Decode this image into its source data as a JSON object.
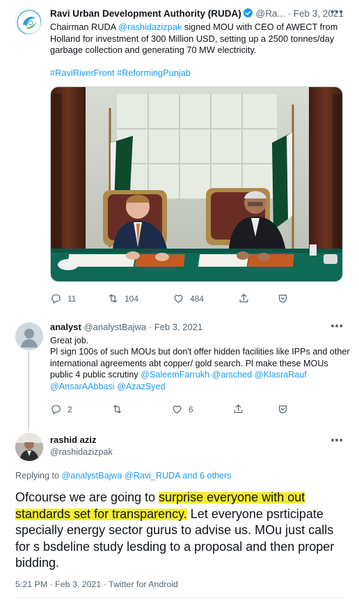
{
  "tweet1": {
    "author_name": "Ravi Urban Development Authority (RUDA)",
    "author_handle_trunc": "@Ra...",
    "separator": "·",
    "date": "Feb 3, 2021",
    "text_pre": "Chairman RUDA ",
    "mention": "@rashidazizpak",
    "text_post": " signed MOU with CEO of AWECT from Holland for investment of 300 Million USD, setting up a 2500 tonnes/day garbage collection and generating 70 MW electricity.",
    "hashtag1": "#RaviRiverFront",
    "hashtag2": "#ReformingPunjab",
    "replies": "11",
    "retweets": "104",
    "likes": "484",
    "icons": [
      "reply-icon",
      "retweet-icon",
      "like-icon",
      "share-icon",
      "tip-icon"
    ]
  },
  "tweet2": {
    "author_name": "analyst",
    "author_handle": "@analystBajwa",
    "separator": "·",
    "date": "Feb 3, 2021",
    "line1": "Great job.",
    "line2": "Pl sign 100s of such MOUs but don't offer hidden facilities like IPPs and other international agreements abt copper/ gold search. Pl make these MOUs public 4 public scrutiny ",
    "mentions": [
      "@SaleemFarrukh",
      "@arsched",
      "@KlasraRauf",
      "@AnsarAAbbasi",
      "@AzazSyed"
    ],
    "replies": "2",
    "retweets": "",
    "likes": "6"
  },
  "tweet3": {
    "author_name": "rashid aziz",
    "author_handle": "@rashidazizpak",
    "replying_prefix": "Replying to ",
    "replying_to": "@analystBajwa @Ravi_RUDA and 6 others",
    "text_a": "Ofcourse we are going to ",
    "text_highlight1": "surprise everyone with out",
    "text_space": " ",
    "text_highlight2": "standards set for transparency.",
    "text_b": " Let everyone psrticipate specially energy sector gurus to advise us. MOu just calls for s bsdeline study lesding to a proposal and then proper bidding.",
    "meta": "5:21 PM · Feb 3, 2021 · Twitter for Android"
  },
  "colors": {
    "link": "#1d9bf0",
    "muted": "#536471",
    "highlight": "#f5ee2a"
  }
}
